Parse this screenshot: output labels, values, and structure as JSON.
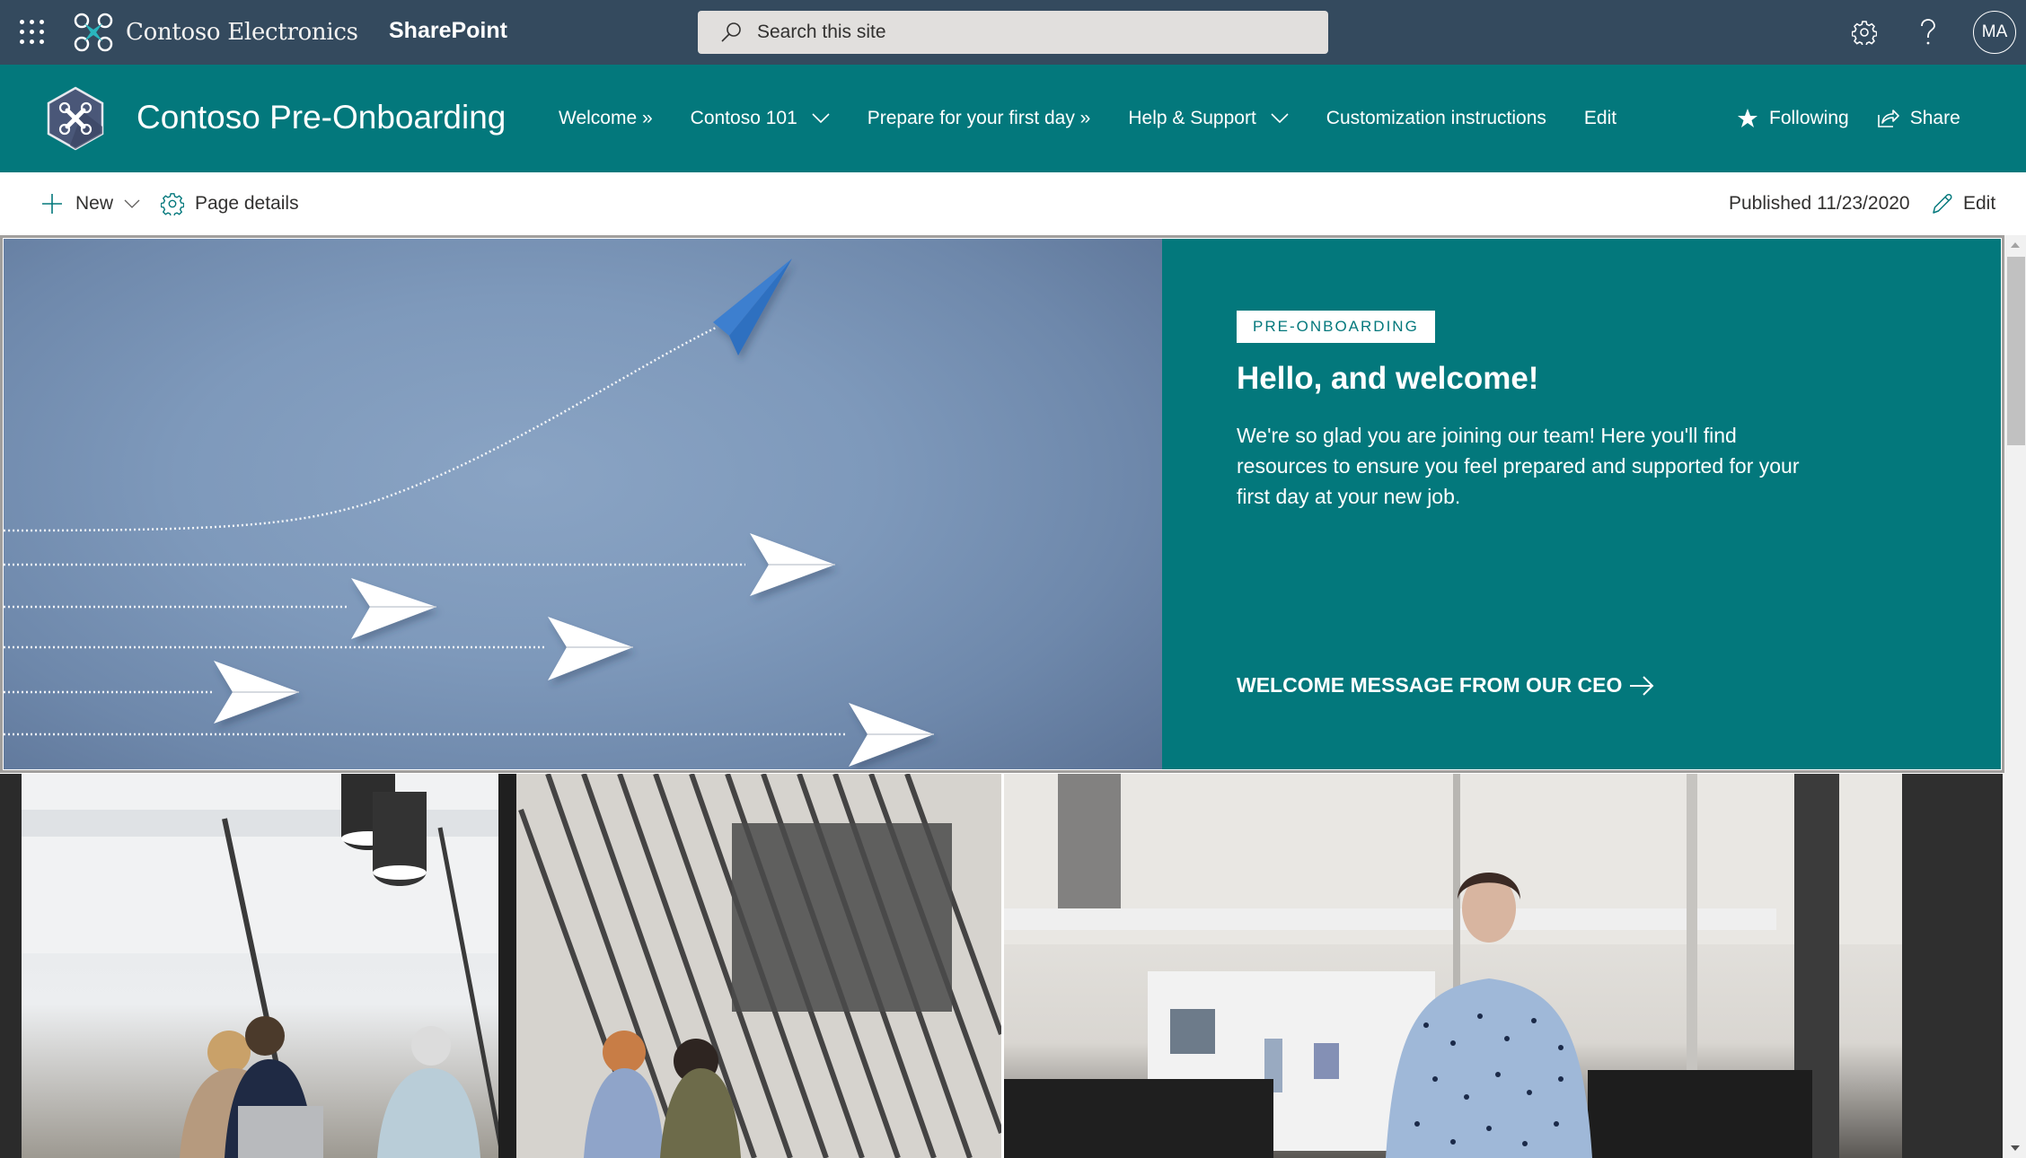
{
  "suitebar": {
    "waffle_icon": "app-launcher-icon",
    "brand_name": "Contoso Electronics",
    "app_name": "SharePoint",
    "search": {
      "placeholder": "Search this site",
      "value": ""
    },
    "settings_icon": "gear-icon",
    "help_icon": "question-icon",
    "avatar_initials": "MA"
  },
  "site": {
    "title": "Contoso Pre-Onboarding",
    "nav": [
      {
        "label": "Welcome »",
        "has_dropdown": false
      },
      {
        "label": "Contoso 101",
        "has_dropdown": true
      },
      {
        "label": "Prepare for your first day »",
        "has_dropdown": false
      },
      {
        "label": "Help & Support",
        "has_dropdown": true
      },
      {
        "label": "Customization instructions",
        "has_dropdown": false
      },
      {
        "label": "Edit",
        "has_dropdown": false
      }
    ],
    "actions": {
      "following": "Following",
      "share": "Share"
    }
  },
  "commandbar": {
    "new_label": "New",
    "page_details_label": "Page details",
    "published": "Published 11/23/2020",
    "edit_label": "Edit"
  },
  "hero": {
    "image_alt": "Paper airplanes with one blue plane flying upward",
    "badge": "PRE-ONBOARDING",
    "title": "Hello, and welcome!",
    "description": "We're so glad you are joining our team! Here you'll find resources to ensure you feel prepared and supported for your first day at your new job.",
    "link": "WELCOME MESSAGE FROM OUR CEO",
    "colors": {
      "panel": "#03787c",
      "badge_text": "#03787c"
    }
  },
  "photos": [
    {
      "alt": "Team meeting in a glass conference room"
    },
    {
      "alt": "Smiling woman in polka-dot shirt standing in office"
    }
  ],
  "theme": {
    "suitebar_bg": "#344a5e",
    "header_bg": "#03787c",
    "accent": "#03787c"
  }
}
